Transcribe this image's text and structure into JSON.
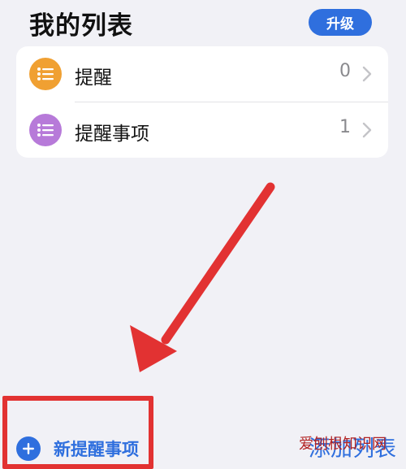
{
  "header": {
    "title": "我的列表",
    "upgrade_label": "升级"
  },
  "lists": [
    {
      "label": "提醒",
      "count": "0",
      "icon": "list-bullet-icon",
      "color": "#f0a032"
    },
    {
      "label": "提醒事项",
      "count": "1",
      "icon": "list-bullet-icon",
      "color": "#b77ad9"
    }
  ],
  "footer": {
    "new_reminder_label": "新提醒事项",
    "add_list_label": "添加列表"
  },
  "overlay": {
    "arrow_color": "#e23232",
    "highlight_color": "#e23232",
    "watermark_text": "爱刨根知识网"
  },
  "colors": {
    "accent": "#2f6fde",
    "background": "#f1f1f6"
  }
}
